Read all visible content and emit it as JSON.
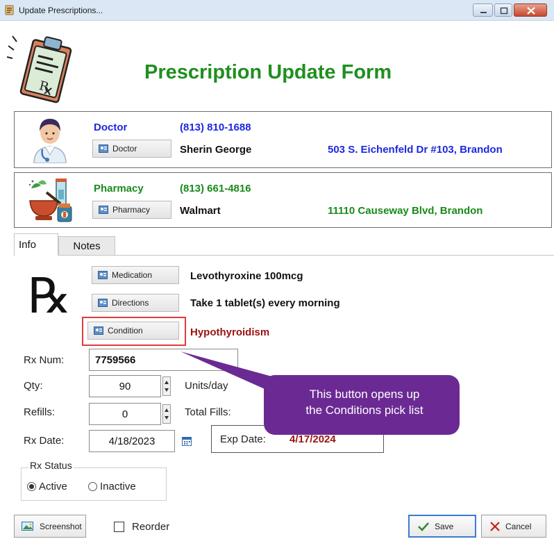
{
  "window": {
    "title": "Update Prescriptions..."
  },
  "form": {
    "title": "Prescription Update Form"
  },
  "doctor": {
    "section_label": "Doctor",
    "phone": "(813) 810-1688",
    "button_label": "Doctor",
    "name": "Sherin George",
    "address": "503 S. Eichenfeld Dr #103, Brandon"
  },
  "pharmacy": {
    "section_label": "Pharmacy",
    "phone": "(813) 661-4816",
    "button_label": "Pharmacy",
    "name": "Walmart",
    "address": "11110 Causeway Blvd, Brandon"
  },
  "tabs": [
    {
      "label": "Info",
      "active": true
    },
    {
      "label": "Notes",
      "active": false
    }
  ],
  "info": {
    "rx_symbol": "℞",
    "medication_button": "Medication",
    "medication_value": "Levothyroxine 100mcg",
    "directions_button": "Directions",
    "directions_value": "Take 1 tablet(s) every morning",
    "condition_button": "Condition",
    "condition_value": "Hypothyroidism",
    "rx_num_label": "Rx Num:",
    "rx_num_value": "7759566",
    "qty_label": "Qty:",
    "qty_value": "90",
    "units_label": "Units/day",
    "refills_label": "Refills:",
    "refills_value": "0",
    "total_fills_label": "Total Fills:",
    "rx_date_label": "Rx Date:",
    "rx_date_value": "4/18/2023",
    "exp_date_label": "Exp Date:",
    "exp_date_value": "4/17/2024",
    "rx_status_label": "Rx Status",
    "status_active": "Active",
    "status_inactive": "Inactive",
    "status_selected": "Active"
  },
  "callout": {
    "line1": "This button opens up",
    "line2": "the Conditions pick list"
  },
  "footer": {
    "screenshot_button": "Screenshot",
    "reorder_label": "Reorder",
    "reorder_checked": false,
    "save_button": "Save",
    "cancel_button": "Cancel"
  },
  "colors": {
    "title_green": "#1f8f1f",
    "doctor_blue": "#1c28e0",
    "pharmacy_green": "#1a8a1a",
    "condition_red": "#9b1111",
    "callout_purple": "#6b2a93",
    "highlight_red": "#e23a3a"
  }
}
